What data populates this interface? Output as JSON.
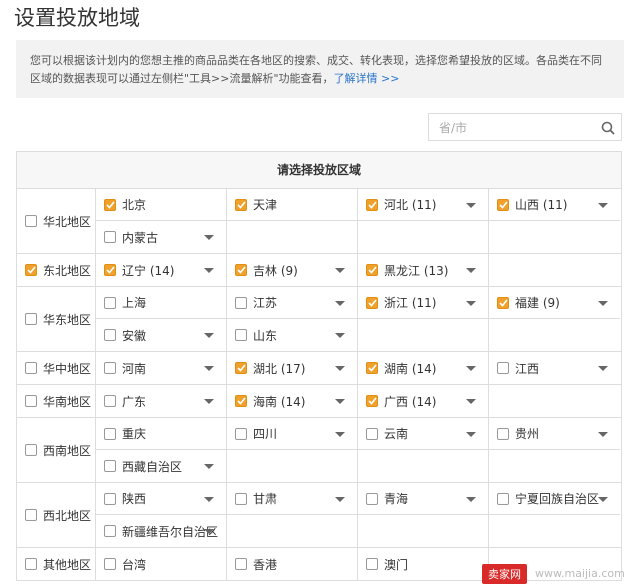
{
  "page": {
    "title": "设置投放地域"
  },
  "notice": {
    "text": "您可以根据该计划内的您想主推的商品品类在各地区的搜索、成交、转化表现，选择您希望投放的区域。各品类在不同区域的数据表现可以通过左侧栏\"工具>>流量解析\"功能查看，",
    "link": "了解详情 >>"
  },
  "search": {
    "placeholder": "省/市",
    "icon": "search-icon"
  },
  "table": {
    "header": "请选择投放区域",
    "groups": [
      {
        "name": "华北地区",
        "checked": false,
        "lines": 2,
        "items": [
          {
            "label": "北京",
            "checked": true,
            "arrow": false
          },
          {
            "label": "天津",
            "checked": true,
            "arrow": false
          },
          {
            "label": "河北 (11)",
            "checked": true,
            "arrow": true
          },
          {
            "label": "山西 (11)",
            "checked": true,
            "arrow": true
          },
          {
            "label": "内蒙古",
            "checked": false,
            "arrow": true
          }
        ]
      },
      {
        "name": "东北地区",
        "checked": true,
        "lines": 1,
        "items": [
          {
            "label": "辽宁 (14)",
            "checked": true,
            "arrow": true
          },
          {
            "label": "吉林 (9)",
            "checked": true,
            "arrow": true
          },
          {
            "label": "黑龙江 (13)",
            "checked": true,
            "arrow": true
          }
        ]
      },
      {
        "name": "华东地区",
        "checked": false,
        "lines": 2,
        "items": [
          {
            "label": "上海",
            "checked": false,
            "arrow": false
          },
          {
            "label": "江苏",
            "checked": false,
            "arrow": true
          },
          {
            "label": "浙江 (11)",
            "checked": true,
            "arrow": true
          },
          {
            "label": "福建 (9)",
            "checked": true,
            "arrow": true
          },
          {
            "label": "安徽",
            "checked": false,
            "arrow": true
          },
          {
            "label": "山东",
            "checked": false,
            "arrow": true
          }
        ]
      },
      {
        "name": "华中地区",
        "checked": false,
        "lines": 1,
        "items": [
          {
            "label": "河南",
            "checked": false,
            "arrow": true
          },
          {
            "label": "湖北 (17)",
            "checked": true,
            "arrow": true
          },
          {
            "label": "湖南 (14)",
            "checked": true,
            "arrow": true
          },
          {
            "label": "江西",
            "checked": false,
            "arrow": true
          }
        ]
      },
      {
        "name": "华南地区",
        "checked": false,
        "lines": 1,
        "items": [
          {
            "label": "广东",
            "checked": false,
            "arrow": true
          },
          {
            "label": "海南 (14)",
            "checked": true,
            "arrow": true
          },
          {
            "label": "广西 (14)",
            "checked": true,
            "arrow": true
          }
        ]
      },
      {
        "name": "西南地区",
        "checked": false,
        "lines": 2,
        "items": [
          {
            "label": "重庆",
            "checked": false,
            "arrow": false
          },
          {
            "label": "四川",
            "checked": false,
            "arrow": true
          },
          {
            "label": "云南",
            "checked": false,
            "arrow": true
          },
          {
            "label": "贵州",
            "checked": false,
            "arrow": true
          },
          {
            "label": "西藏自治区",
            "checked": false,
            "arrow": true
          }
        ]
      },
      {
        "name": "西北地区",
        "checked": false,
        "lines": 2,
        "items": [
          {
            "label": "陕西",
            "checked": false,
            "arrow": true
          },
          {
            "label": "甘肃",
            "checked": false,
            "arrow": true
          },
          {
            "label": "青海",
            "checked": false,
            "arrow": true
          },
          {
            "label": "宁夏回族自治区",
            "checked": false,
            "arrow": true
          },
          {
            "label": "新疆维吾尔自治区",
            "checked": false,
            "arrow": true
          }
        ]
      },
      {
        "name": "其他地区",
        "checked": false,
        "lines": 1,
        "items": [
          {
            "label": "台湾",
            "checked": false,
            "arrow": false
          },
          {
            "label": "香港",
            "checked": false,
            "arrow": false
          },
          {
            "label": "澳门",
            "checked": false,
            "arrow": false
          }
        ]
      }
    ]
  },
  "watermark": {
    "badge": "卖家网",
    "url": "www.maijia.com"
  },
  "colors": {
    "checked": "#f0a12b",
    "link": "#2a74c9",
    "border": "#dddddd"
  }
}
